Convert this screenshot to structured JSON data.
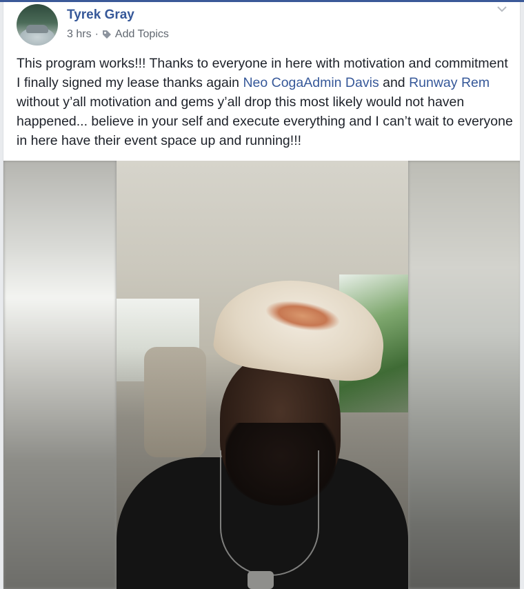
{
  "post": {
    "author": "Tyrek Gray",
    "time": "3 hrs",
    "separator": "·",
    "add_topics": "Add Topics",
    "text_parts": {
      "p1": "This program works!!! Thanks to everyone in here with motivation and commitment I finally signed my lease thanks again ",
      "link1": "Neo CogaAdmin Davis",
      "p2": " and ",
      "link2": "Runway Rem",
      "p3": " without y’all motivation and gems y’all drop this most likely would not haven happened... believe in your self and execute everything and I can’t wait to everyone in here have their event space up and running!!!"
    }
  },
  "icons": {
    "tag": "tag-icon",
    "chevron": "chevron-down-icon"
  },
  "colors": {
    "link": "#365899",
    "text": "#1d2129",
    "meta": "#606770",
    "background": "#e9ebee",
    "topbar": "#3b5998"
  }
}
